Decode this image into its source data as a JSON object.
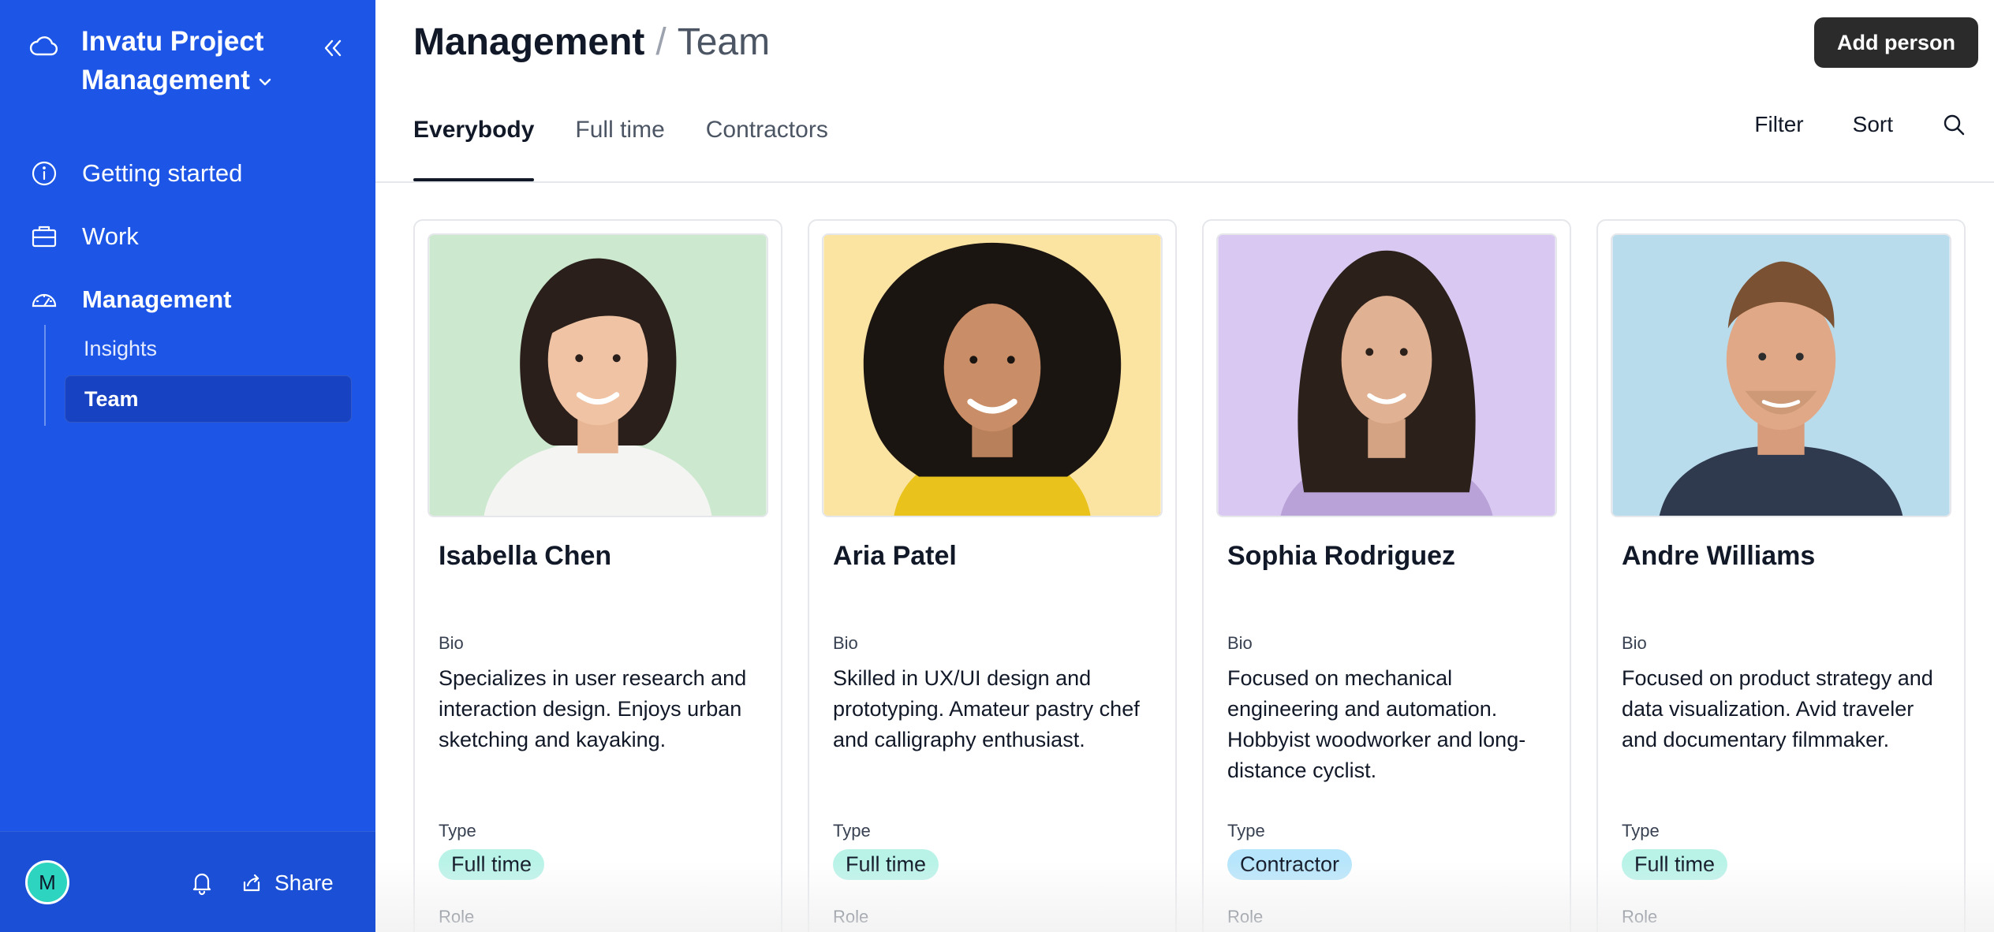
{
  "sidebar": {
    "workspace_name": "Invatu Project Management",
    "nav": [
      {
        "label": "Getting started",
        "icon": "info-icon"
      },
      {
        "label": "Work",
        "icon": "briefcase-icon"
      },
      {
        "label": "Management",
        "icon": "gauge-icon"
      }
    ],
    "subnav": [
      {
        "label": "Insights"
      },
      {
        "label": "Team"
      }
    ],
    "footer": {
      "avatar_initial": "M",
      "share_label": "Share"
    }
  },
  "header": {
    "breadcrumb_parent": "Management",
    "breadcrumb_separator": "/",
    "breadcrumb_current": "Team",
    "add_button_label": "Add person"
  },
  "tabs": [
    {
      "label": "Everybody",
      "active": true
    },
    {
      "label": "Full time",
      "active": false
    },
    {
      "label": "Contractors",
      "active": false
    }
  ],
  "toolbar": {
    "filter_label": "Filter",
    "sort_label": "Sort"
  },
  "field_labels": {
    "bio": "Bio",
    "type": "Type",
    "role": "Role"
  },
  "people": [
    {
      "name": "Isabella Chen",
      "bio": "Specializes in user research and interaction design. Enjoys urban sketching and kayaking.",
      "type": "Full time",
      "photo_bg": "#cce8cf"
    },
    {
      "name": "Aria Patel",
      "bio": "Skilled in UX/UI design and prototyping. Amateur pastry chef and calligraphy enthusiast.",
      "type": "Full time",
      "photo_bg": "#fbe3a1"
    },
    {
      "name": "Sophia Rodriguez",
      "bio": "Focused on mechanical engineering and automation. Hobbyist woodworker and long-distance cyclist.",
      "type": "Contractor",
      "photo_bg": "#d9c8f2"
    },
    {
      "name": "Andre Williams",
      "bio": "Focused on product strategy and data visualization. Avid traveler and documentary filmmaker.",
      "type": "Full time",
      "photo_bg": "#b9dcec"
    }
  ],
  "colors": {
    "sidebar_bg": "#1d56e6",
    "badge_full_time": "#b9f3e8",
    "badge_contractor": "#b7e5fb"
  }
}
